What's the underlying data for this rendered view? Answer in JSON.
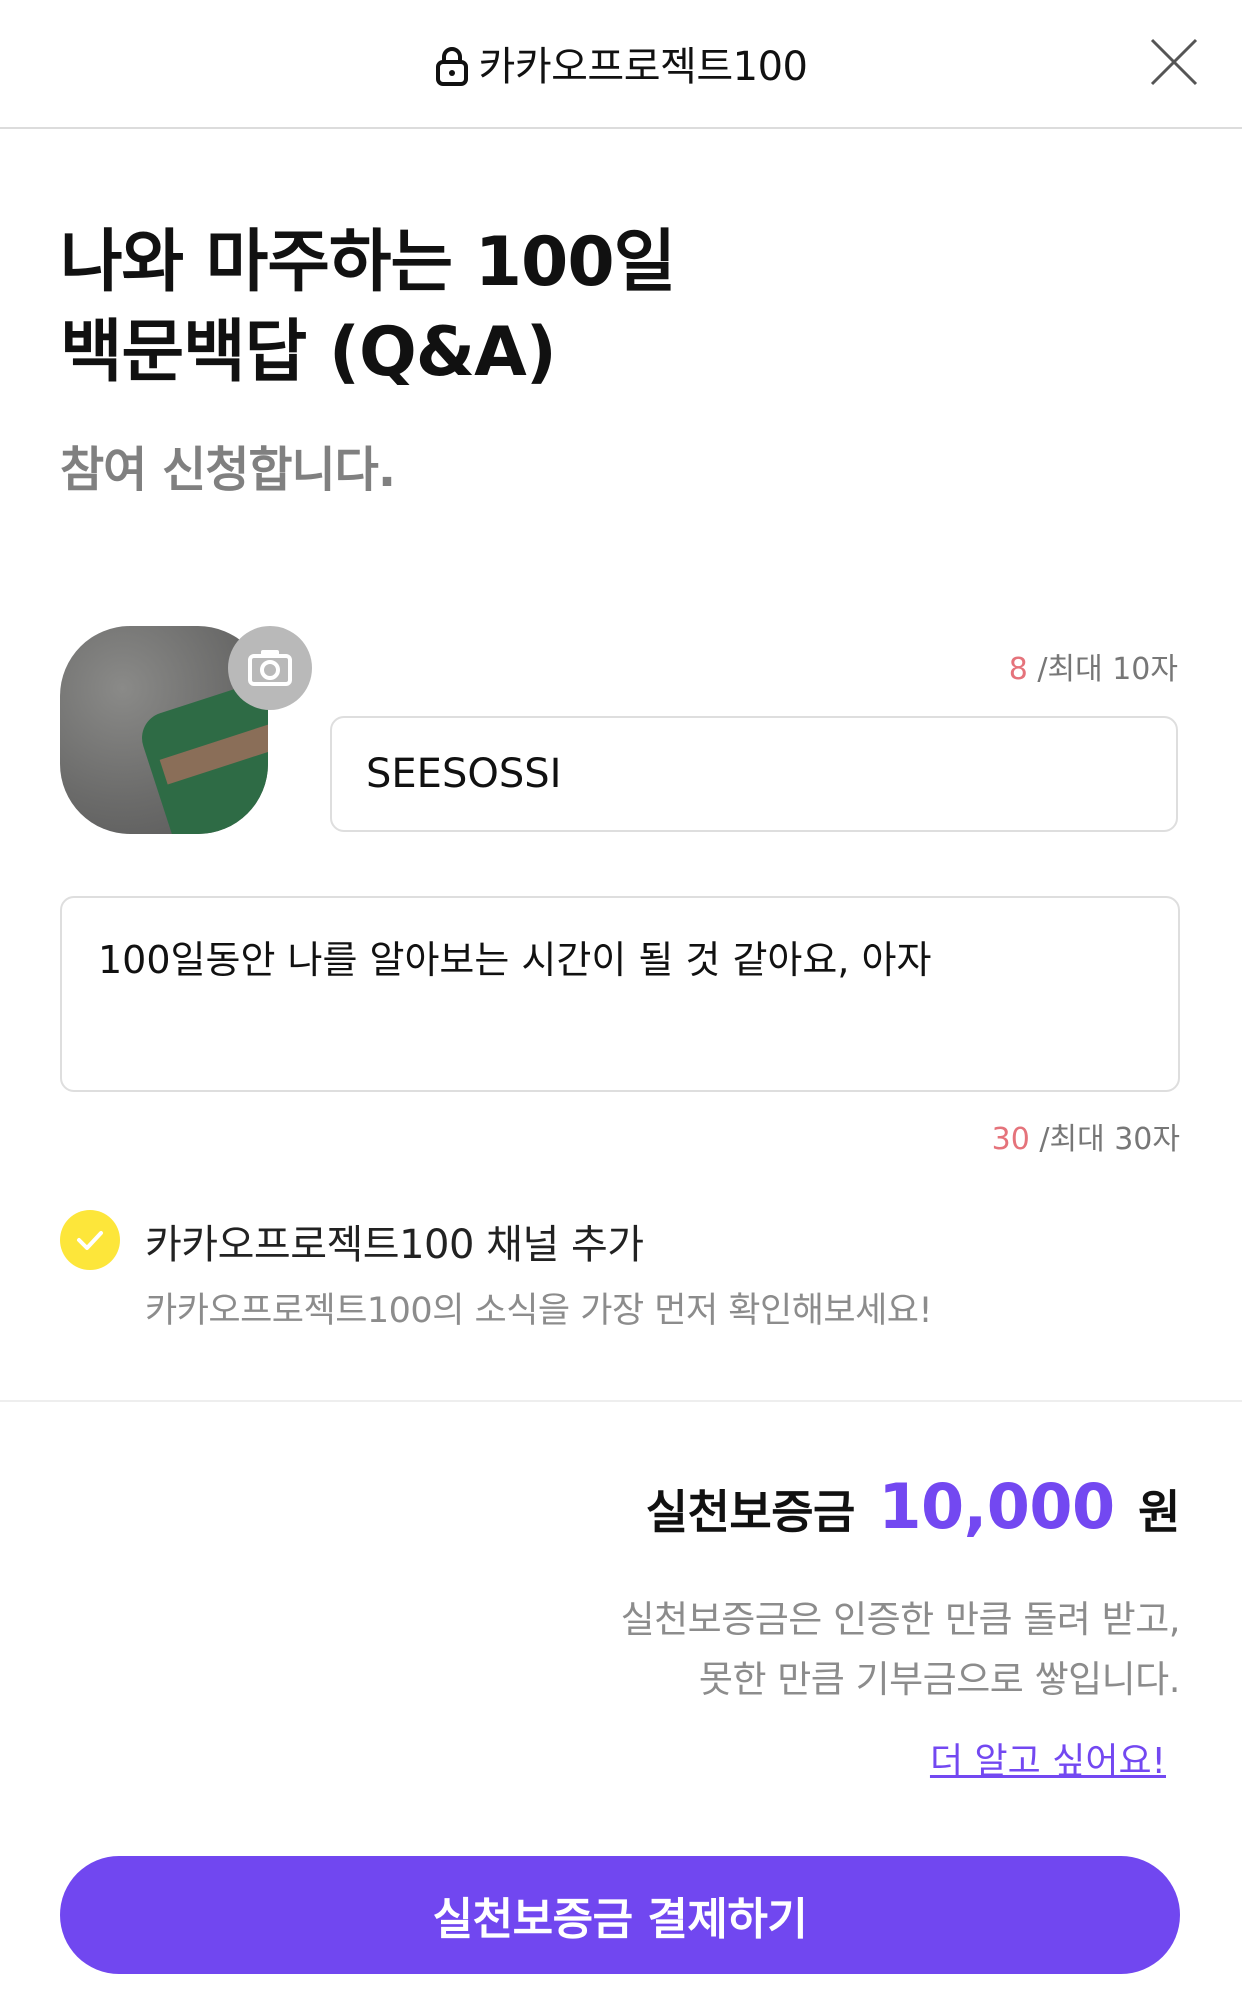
{
  "header": {
    "title": "카카오프로젝트100"
  },
  "title": {
    "line1": "나와 마주하는 100일",
    "line2": "백문백답 (Q&A)"
  },
  "subtitle": "참여 신청합니다.",
  "nickname": {
    "count": "8",
    "max_label": "/최대 10자",
    "value": "SEESOSSI"
  },
  "intro": {
    "value": "100일동안 나를 알아보는 시간이 될 것 같아요, 아자",
    "count": "30",
    "max_label": "/최대 30자"
  },
  "channel": {
    "label": "카카오프로젝트100 채널 추가",
    "description": "카카오프로젝트100의 소식을 가장 먼저 확인해보세요!",
    "checked": true
  },
  "deposit": {
    "label": "실천보증금",
    "amount": "10,000",
    "unit": "원",
    "desc_line1": "실천보증금은 인증한 만큼 돌려 받고,",
    "desc_line2": "못한 만큼 기부금으로 쌓입니다.",
    "learn_more": "더 알고 싶어요!"
  },
  "pay_button": "실천보증금 결제하기",
  "colors": {
    "accent": "#7147f0",
    "check": "#fde63a",
    "counter": "#e5737b"
  }
}
